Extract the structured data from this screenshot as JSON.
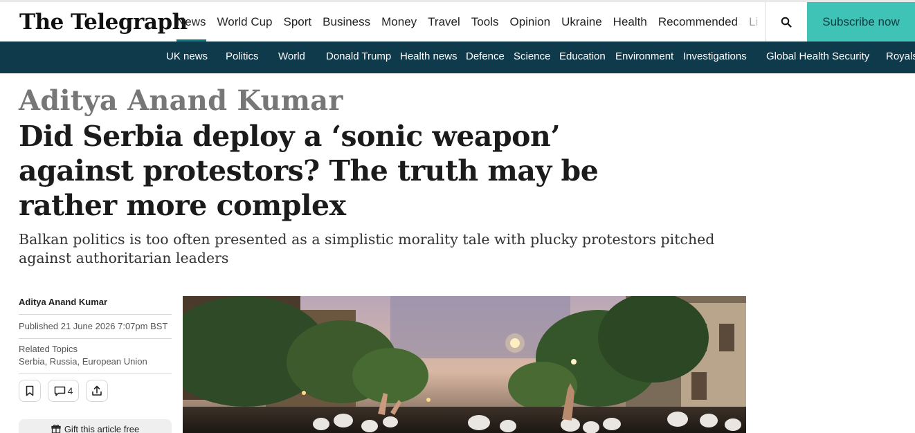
{
  "header": {
    "logo_text": "The Telegraph",
    "nav": [
      "News",
      "World Cup",
      "Sport",
      "Business",
      "Money",
      "Travel",
      "Tools",
      "Opinion",
      "Ukraine",
      "Health",
      "Recommended",
      "Lifestyle"
    ],
    "active_nav": "News",
    "subscribe_label": "Subscribe now",
    "search_icon": "search-icon"
  },
  "subnav": [
    "UK news",
    "Politics",
    "World",
    "Donald Trump",
    "Health news",
    "Defence",
    "Science",
    "Education",
    "Environment",
    "Investigations",
    "Global Health Security",
    "Royals"
  ],
  "article": {
    "author_heading": "Aditya Anand Kumar",
    "headline": "Did Serbia deploy a ‘sonic weapon’ against protestors? The truth may be rather more complex",
    "standfirst": "Balkan politics is too often presented as a simplistic morality tale with plucky protestors pitched against authoritarian leaders",
    "byline": {
      "author": "Aditya Anand Kumar",
      "published": "Published 21 June 2026 7:07pm BST",
      "related_label": "Related Topics",
      "related_topics": "Serbia, Russia, European Union",
      "comments_count": "4",
      "gift_label": "Gift this article free"
    }
  },
  "colors": {
    "accent": "#0a7b83",
    "subscribe_bg": "#3fc3b6",
    "subnav_bg": "#0e3a4b"
  }
}
